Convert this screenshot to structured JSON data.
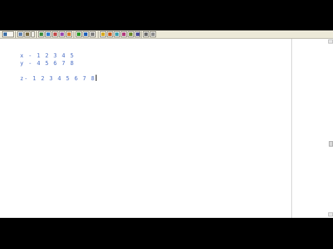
{
  "editor": {
    "lines": [
      {
        "text": "x - 1 2 3 4 5"
      },
      {
        "text": "y - 4 5 6 7 8"
      },
      {
        "text": "z- 1 2 3 4 5 6 7 8"
      }
    ]
  },
  "toolbar": {
    "buttons": [
      {
        "icon": "graph-icon"
      },
      {
        "icon": "window-icon"
      },
      {
        "icon": "function-icon"
      },
      {
        "icon": "zoom-icon"
      },
      {
        "icon": "select-icon"
      },
      {
        "icon": "insert-icon"
      },
      {
        "icon": "run-icon"
      },
      {
        "icon": "check-icon"
      },
      {
        "icon": "format-icon"
      },
      {
        "icon": "palette-icon"
      },
      {
        "icon": "text-icon"
      },
      {
        "icon": "settings-icon"
      }
    ]
  },
  "colors": {
    "text_blue": "#4469c4",
    "toolbar_bg": "#ece9d8",
    "page_bg": "#ffffff"
  }
}
